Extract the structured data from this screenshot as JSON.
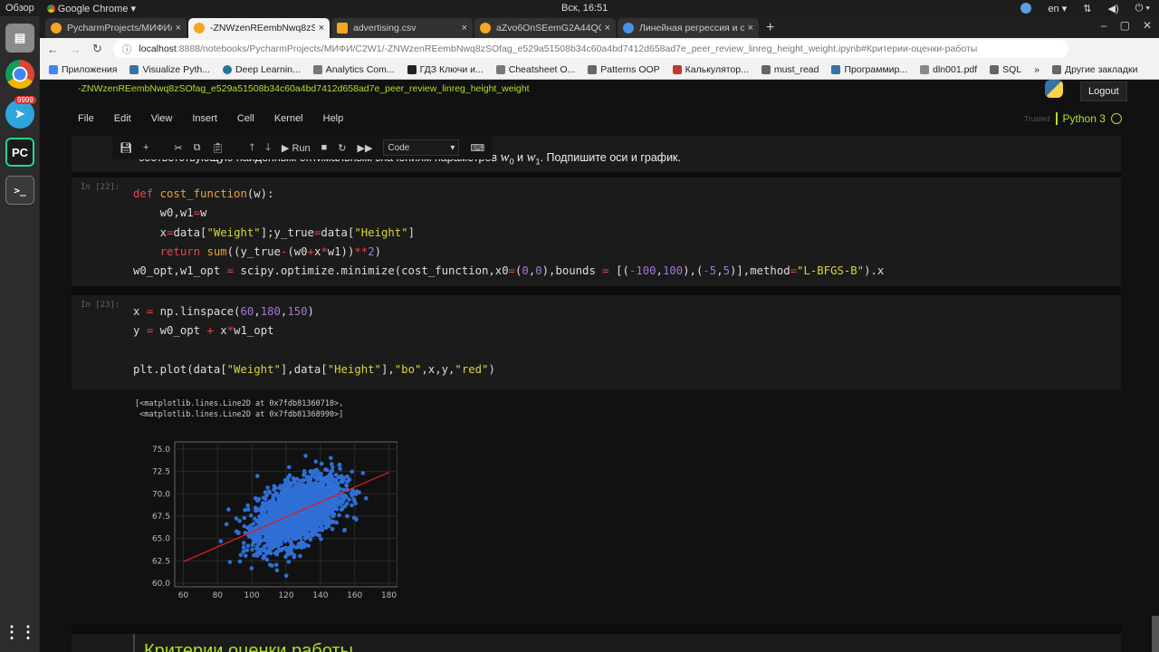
{
  "system": {
    "activities": "Обзор",
    "app": "Google Chrome",
    "clock": "Вск, 16:51",
    "lang": "en",
    "telegram_badge": "9999"
  },
  "tabs": [
    {
      "title": "PycharmProjects/МИФИ/",
      "color": "#f5a623"
    },
    {
      "title": "-ZNWzenREembNwq8zSC",
      "color": "#f5a623",
      "active": true
    },
    {
      "title": "advertising.csv",
      "color": "#f5a623"
    },
    {
      "title": "aZvo6OnSEemG2A44QOI",
      "color": "#f5a623"
    },
    {
      "title": "Линейная регрессия и о",
      "color": "#4a8fe7"
    }
  ],
  "address": {
    "host": "localhost",
    "path": ":8888/notebooks/PycharmProjects/МИФИ/C2W1/-ZNWzenREembNwq8zSOfag_e529a51508b34c60a4bd7412d658ad7e_peer_review_linreg_height_weight.ipynb#Критерии-оценки-работы"
  },
  "bookmarks": [
    "Приложения",
    "Visualize Pyth...",
    "Deep Learnin...",
    "Analytics Com...",
    "ГДЗ Ключи и...",
    "Cheatsheet O...",
    "Patterns OOP",
    "Калькулятор...",
    "must_read",
    "Программир...",
    "dln001.pdf",
    "SQL",
    "»",
    "Другие закладки"
  ],
  "jupyter": {
    "notebook_name": "-ZNWzenREembNwq8zSOfag_e529a51508b34c60a4bd7412d658ad7e_peer_review_linreg_height_weight",
    "logout": "Logout",
    "menu": [
      "File",
      "Edit",
      "View",
      "Insert",
      "Cell",
      "Kernel",
      "Help"
    ],
    "trusted": "Trusted",
    "kernel": "Python 3",
    "toolbar": {
      "run": "Run",
      "cell_type": "Code"
    }
  },
  "cells": {
    "markdown_top": "соответствующую найденным оптимальным значениям параметров",
    "markdown_w0": "w",
    "markdown_w0_sub": "0",
    "markdown_and": " и ",
    "markdown_w1": "w",
    "markdown_w1_sub": "1",
    "markdown_tail": ". Подпишите оси и график.",
    "prompt22": "In [22]:",
    "prompt23": "In [23]:",
    "output_repr": "[<matplotlib.lines.Line2D at 0x7fdb81360710>,\n <matplotlib.lines.Line2D at 0x7fdb81368990>]",
    "heading": "Критерии оценки работы"
  },
  "chart_data": {
    "type": "scatter",
    "title": "",
    "xlabel": "",
    "ylabel": "",
    "xlim": [
      55,
      185
    ],
    "ylim": [
      59.6,
      75.8
    ],
    "x_ticks": [
      60,
      80,
      100,
      120,
      140,
      160,
      180
    ],
    "y_ticks": [
      60.0,
      62.5,
      65.0,
      67.5,
      70.0,
      72.5,
      75.0
    ],
    "series": [
      {
        "type": "scatter",
        "color": "#2f6fd6",
        "marker": "o",
        "distribution": {
          "x_mean": 127,
          "x_sd": 12,
          "y_mean": 68,
          "y_sd": 1.9,
          "corr": 0.5,
          "n": 2500
        }
      },
      {
        "type": "line",
        "color": "#d62020",
        "x": [
          60,
          180
        ],
        "y": [
          62.4,
          72.4
        ]
      }
    ],
    "grid": true
  }
}
